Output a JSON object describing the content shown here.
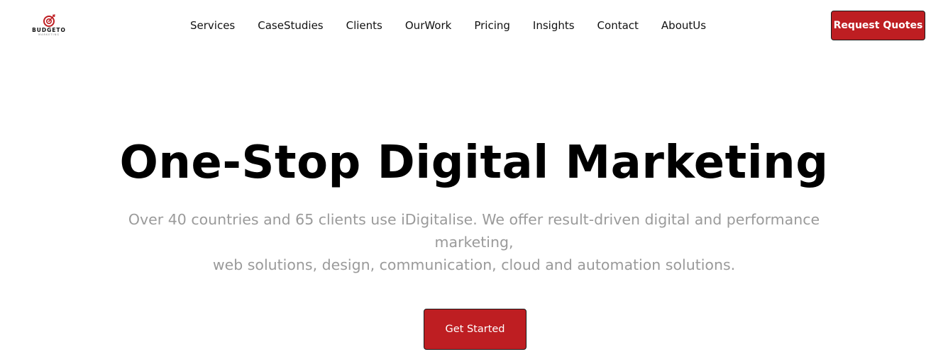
{
  "brand": {
    "name": "BUDGETO",
    "tagline": "MARKETING",
    "logo_icon": "target-icon",
    "accent_color": "#be1e22"
  },
  "nav": {
    "items": [
      {
        "label": "Services"
      },
      {
        "label": "CaseStudies"
      },
      {
        "label": "Clients"
      },
      {
        "label": "OurWork"
      },
      {
        "label": "Pricing"
      },
      {
        "label": "Insights"
      },
      {
        "label": "Contact"
      },
      {
        "label": "AboutUs"
      }
    ],
    "cta_label": "Request Quotes"
  },
  "hero": {
    "title": "One-Stop Digital Marketing",
    "subtitle_line1": "Over 40 countries and 65 clients use iDigitalise. We offer result-driven digital and performance marketing,",
    "subtitle_line2": "web solutions, design, communication, cloud and automation solutions.",
    "cta_label": "Get Started"
  }
}
